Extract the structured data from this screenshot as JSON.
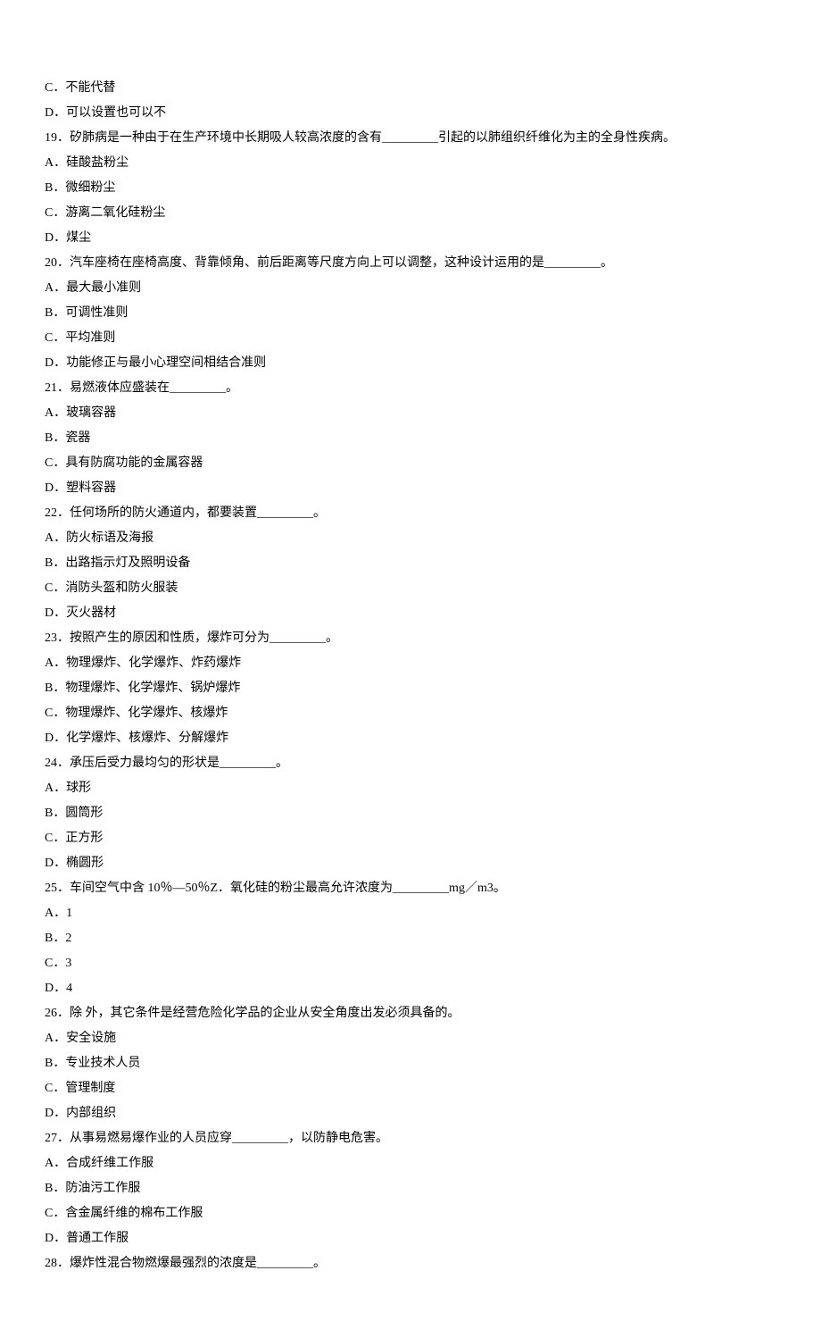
{
  "lines": [
    "C．不能代替",
    "D．可以设置也可以不",
    "19．矽肺病是一种由于在生产环境中长期吸人较高浓度的含有_________引起的以肺组织纤维化为主的全身性疾病。",
    "A．硅酸盐粉尘",
    "B．微细粉尘",
    "C．游离二氧化硅粉尘",
    "D．煤尘",
    "20．汽车座椅在座椅高度、背靠倾角、前后距离等尺度方向上可以调整，这种设计运用的是_________。",
    "A．最大最小准则",
    "B．可调性准则",
    "C．平均准则",
    "D．功能修正与最小心理空间相结合准则",
    "21．易燃液体应盛装在_________。",
    "A．玻璃容器",
    "B．瓷器",
    "C．具有防腐功能的金属容器",
    "D．塑料容器",
    "22．任何场所的防火通道内，都要装置_________。",
    "A．防火标语及海报",
    "B．出路指示灯及照明设备",
    "C．消防头盔和防火服装",
    "D．灭火器材",
    "23．按照产生的原因和性质，爆炸可分为_________。",
    "A．物理爆炸、化学爆炸、炸药爆炸",
    "B．物理爆炸、化学爆炸、锅炉爆炸",
    "C．物理爆炸、化学爆炸、核爆炸",
    "D．化学爆炸、核爆炸、分解爆炸",
    "24．承压后受力最均匀的形状是_________。",
    "A．球形",
    "B．圆筒形",
    "C．正方形",
    "D．椭圆形",
    "25．车间空气中含 10％—50％Z．氧化硅的粉尘最高允许浓度为_________mg／m3。",
    "A．1",
    "B．2",
    "C．3",
    "D．4",
    "26．除 外，其它条件是经营危险化学品的企业从安全角度出发必须具备的。",
    "A．安全设施",
    "B．专业技术人员",
    "C．管理制度",
    "D．内部组织",
    "27．从事易燃易爆作业的人员应穿_________，以防静电危害。",
    "A．合成纤维工作服",
    "B．防油污工作服",
    "C．含金属纤维的棉布工作服",
    "D．普通工作服",
    "28．爆炸性混合物燃爆最强烈的浓度是_________。"
  ]
}
